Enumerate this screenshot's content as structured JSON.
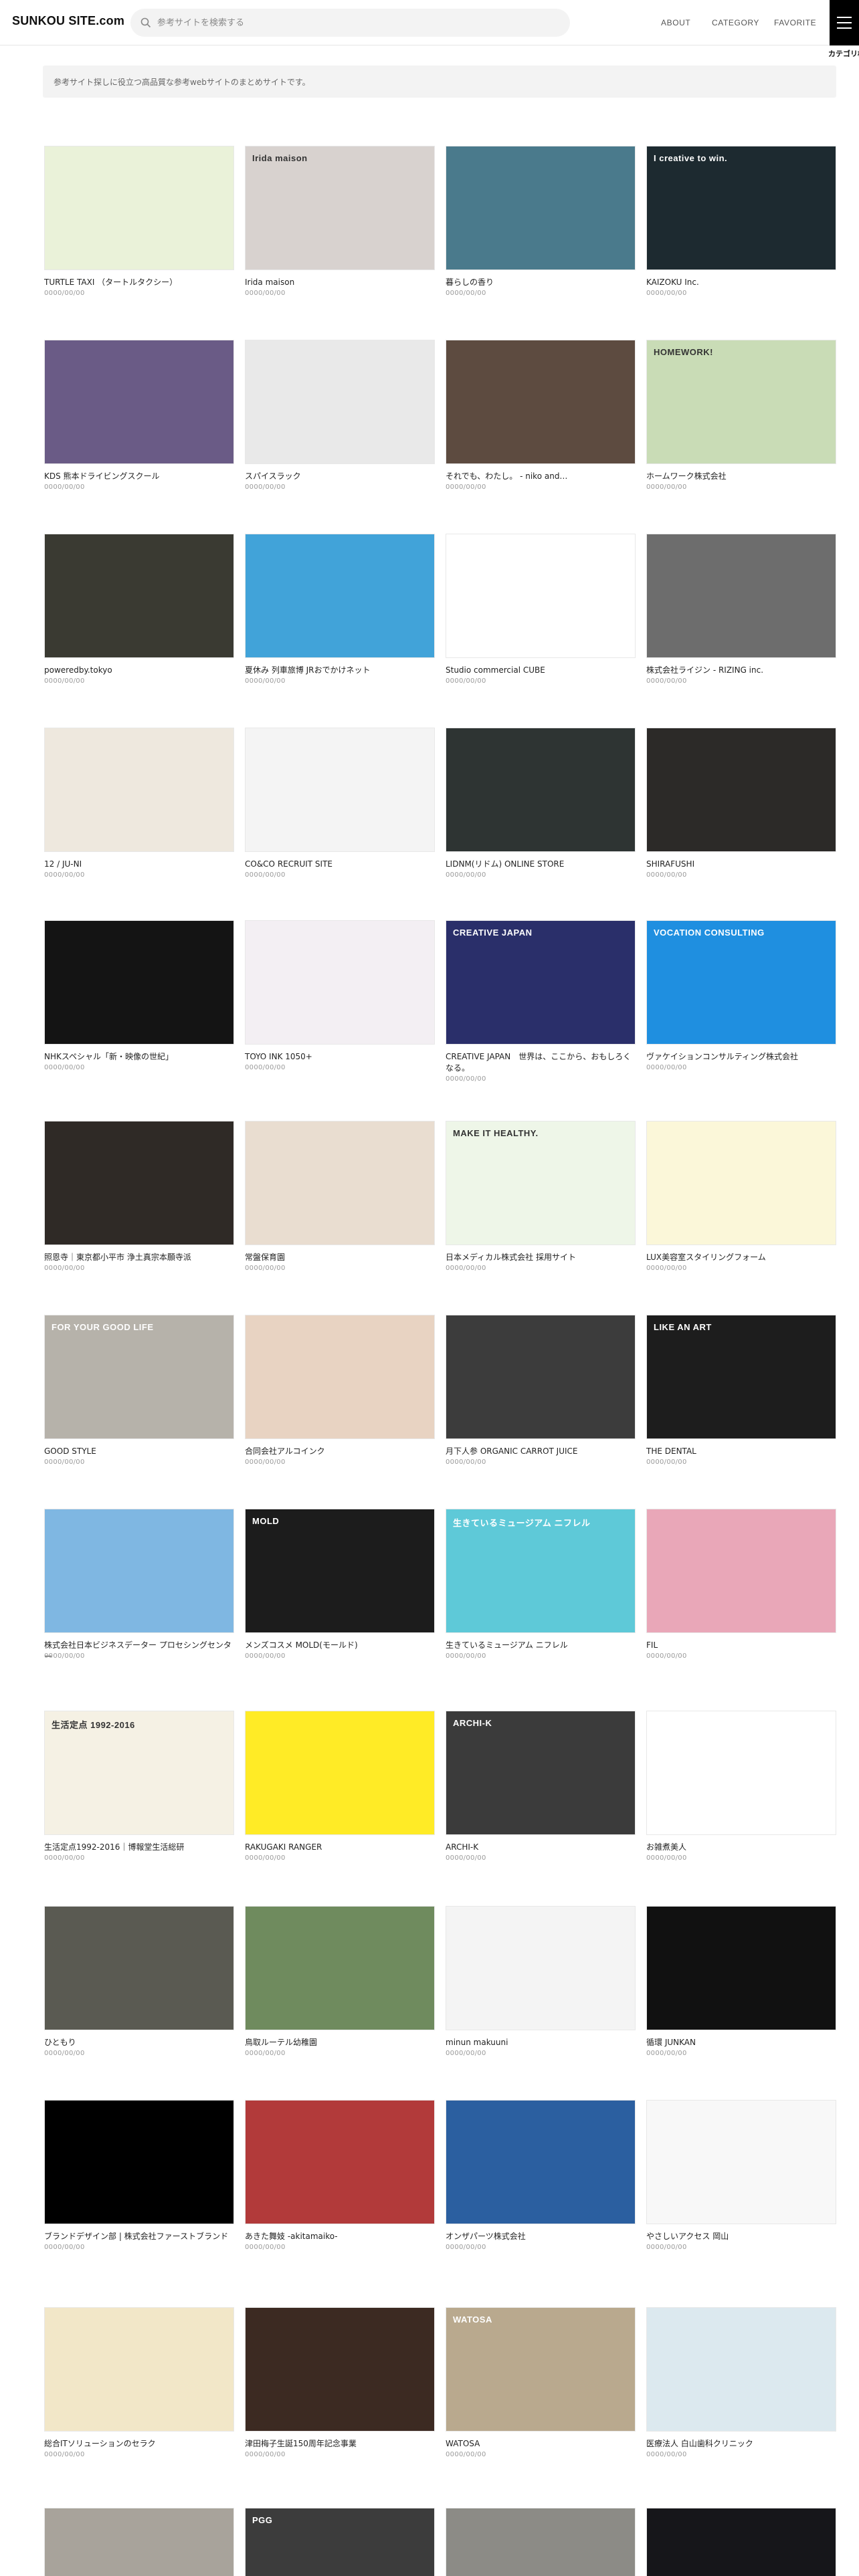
{
  "header": {
    "logo": "SUNKOU SITE.com",
    "search_placeholder": "参考サイトを検索する",
    "nav": {
      "about": "ABOUT",
      "category": "CATEGORY",
      "favorite": "FAVORITE"
    },
    "menu_label": "カテゴリ検索"
  },
  "intro": "参考サイト探しに役立つ高品質な参考webサイトのまとめサイトです。",
  "date_placeholder": "0000/00/00",
  "colors": {
    "accent": "#000000",
    "search_bg": "#f3f3f3",
    "muted": "#999999"
  },
  "cards": [
    {
      "title": "TURTLE TAXI （タートルタクシー）",
      "bg": "#eaf2d9",
      "caption": ""
    },
    {
      "title": "Irida maison",
      "bg": "#d8d2cf",
      "caption": "Irida maison"
    },
    {
      "title": "暮らしの香り",
      "bg": "#4a7a8c",
      "caption": ""
    },
    {
      "title": "KAIZOKU Inc.",
      "bg": "#1d2a30",
      "caption": "I creative to win."
    },
    {
      "title": "KDS 熊本ドライビングスクール",
      "bg": "#6a5b86",
      "caption": ""
    },
    {
      "title": "スパイスラック",
      "bg": "#e9e9e9",
      "caption": ""
    },
    {
      "title": "それでも、わたし。 - niko and…",
      "bg": "#5d4b40",
      "caption": ""
    },
    {
      "title": "ホームワーク株式会社",
      "bg": "#c9dcb6",
      "caption": "HOMEWORK!"
    },
    {
      "title": "poweredby.tokyo",
      "bg": "#3a3a32",
      "caption": ""
    },
    {
      "title": "夏休み 列車旅博 JRおでかけネット",
      "bg": "#41a3d9",
      "caption": ""
    },
    {
      "title": "Studio commercial CUBE",
      "bg": "#ffffff",
      "caption": ""
    },
    {
      "title": "株式会社ライジン - RIZING inc.",
      "bg": "#6d6d6d",
      "caption": ""
    },
    {
      "title": "12 / JU-NI",
      "bg": "#eee8de",
      "caption": ""
    },
    {
      "title": "CO&CO RECRUIT SITE",
      "bg": "#f4f4f4",
      "caption": ""
    },
    {
      "title": "LIDNM(リドム) ONLINE STORE",
      "bg": "#2e3433",
      "caption": ""
    },
    {
      "title": "SHIRAFUSHI",
      "bg": "#2c2a28",
      "caption": ""
    },
    {
      "title": "NHKスペシャル「新・映像の世紀」",
      "bg": "#141414",
      "caption": ""
    },
    {
      "title": "TOYO INK 1050+",
      "bg": "#f3eff3",
      "caption": ""
    },
    {
      "title": "CREATIVE JAPAN　世界は、ここから、おもしろくなる。",
      "bg": "#2a2f6a",
      "caption": "CREATIVE JAPAN"
    },
    {
      "title": "ヴァケイションコンサルティング株式会社",
      "bg": "#1f8fe0",
      "caption": "VOCATION CONSULTING"
    },
    {
      "title": "照恩寺｜東京都小平市 浄土真宗本願寺派",
      "bg": "#2f2a26",
      "caption": ""
    },
    {
      "title": "常盤保育園",
      "bg": "#e9ddd0",
      "caption": ""
    },
    {
      "title": "日本メディカル株式会社 採用サイト",
      "bg": "#eef6e8",
      "caption": "MAKE IT HEALTHY."
    },
    {
      "title": "LUX美容室スタイリングフォーム",
      "bg": "#fbf7d9",
      "caption": ""
    },
    {
      "title": "GOOD STYLE",
      "bg": "#b6b2aa",
      "caption": "FOR YOUR GOOD LIFE"
    },
    {
      "title": "合同会社アルコインク",
      "bg": "#e8d3c2",
      "caption": ""
    },
    {
      "title": "月下人参 ORGANIC CARROT JUICE",
      "bg": "#3c3c3c",
      "caption": ""
    },
    {
      "title": "THE DENTAL",
      "bg": "#1d1d1d",
      "caption": "LIKE    AN ART"
    },
    {
      "title": "株式会社日本ビジネスデーター プロセシングセンター",
      "bg": "#7fb7e2",
      "caption": ""
    },
    {
      "title": "メンズコスメ MOLD(モールド)",
      "bg": "#1c1c1c",
      "caption": "MOLD"
    },
    {
      "title": "生きているミュージアム ニフレル",
      "bg": "#5ec9d8",
      "caption": "生きているミュージアム ニフレル"
    },
    {
      "title": "FIL",
      "bg": "#e9a7b8",
      "caption": ""
    },
    {
      "title": "生活定点1992-2016｜博報堂生活総研",
      "bg": "#f5f1e4",
      "caption": "生活定点 1992-2016"
    },
    {
      "title": "RAKUGAKI RANGER",
      "bg": "#ffeb26",
      "caption": ""
    },
    {
      "title": "ARCHI-K",
      "bg": "#3b3b3b",
      "caption": "ARCHI-K"
    },
    {
      "title": "お雑煮美人",
      "bg": "#ffffff",
      "caption": ""
    },
    {
      "title": "ひともり",
      "bg": "#5a5a52",
      "caption": ""
    },
    {
      "title": "鳥取ルーテル幼稚園",
      "bg": "#6f8b5e",
      "caption": ""
    },
    {
      "title": "minun makuuni",
      "bg": "#f4f4f4",
      "caption": ""
    },
    {
      "title": "循環 JUNKAN",
      "bg": "#111111",
      "caption": ""
    },
    {
      "title": "ブランドデザイン部 | 株式会社ファーストブランド",
      "bg": "#000000",
      "caption": ""
    },
    {
      "title": "あきた舞妓 -akitamaiko-",
      "bg": "#b23a3a",
      "caption": ""
    },
    {
      "title": "オンザパーツ株式会社",
      "bg": "#2b5fa0",
      "caption": ""
    },
    {
      "title": "やさしいアクセス 岡山",
      "bg": "#f8f8f8",
      "caption": ""
    },
    {
      "title": "総合ITソリューションのセラク",
      "bg": "#f2e7c8",
      "caption": ""
    },
    {
      "title": "津田梅子生誕150周年記念事業",
      "bg": "#3c2a22",
      "caption": ""
    },
    {
      "title": "WATOSA",
      "bg": "#b9a98e",
      "caption": "WATOSA"
    },
    {
      "title": "医療法人 白山歯科クリニック",
      "bg": "#dce9ef",
      "caption": ""
    },
    {
      "title": "",
      "bg": "#a8a39b",
      "caption": ""
    },
    {
      "title": "",
      "bg": "#3c3c3c",
      "caption": "PGG"
    },
    {
      "title": "",
      "bg": "#8c8b86",
      "caption": ""
    },
    {
      "title": "",
      "bg": "#16161a",
      "caption": ""
    }
  ]
}
